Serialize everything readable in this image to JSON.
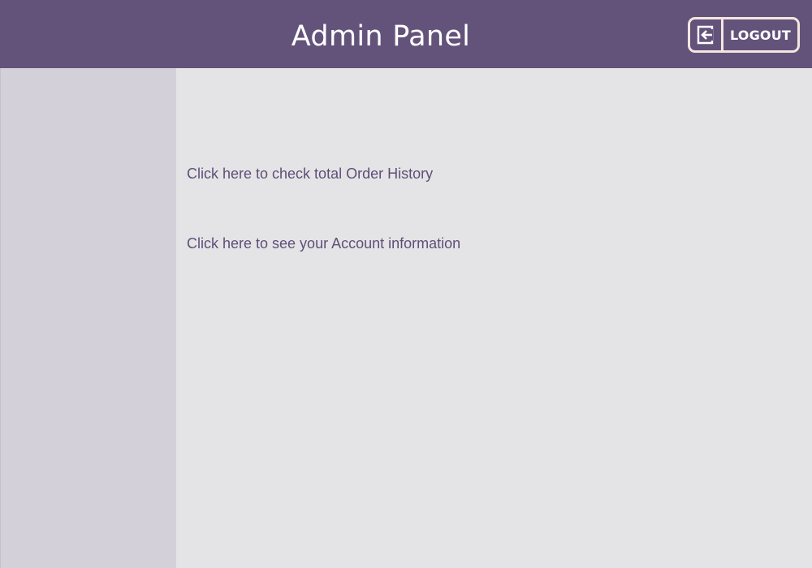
{
  "header": {
    "title": "Admin Panel",
    "logout_label": "LOGOUT",
    "logout_icon": "logout-icon"
  },
  "main": {
    "links": [
      {
        "label": "Click here to check total Order History"
      },
      {
        "label": "Click here to see your Account information"
      }
    ]
  },
  "colors": {
    "header_bg": "#63537b",
    "sidebar_bg": "#d3d0da",
    "content_bg": "#e4e4e6",
    "link_text": "#5d4f77",
    "button_border": "#f3e6de"
  }
}
